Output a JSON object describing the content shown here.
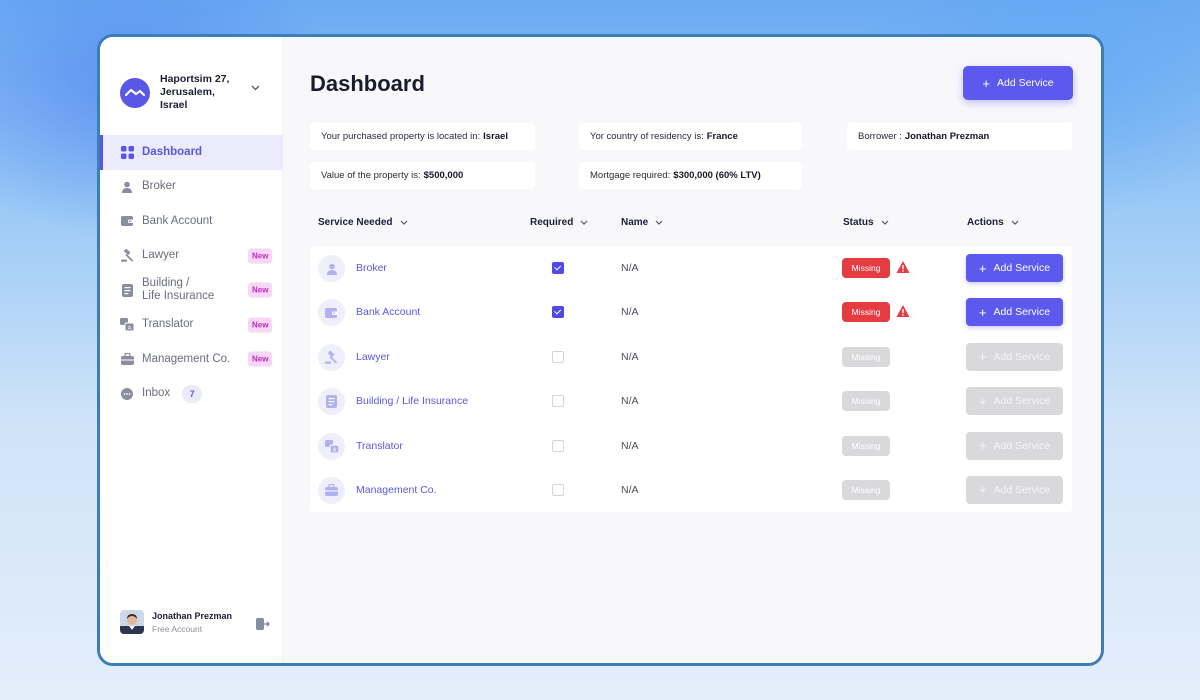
{
  "brand": {
    "address_line1": "Haportsim 27,",
    "address_line2": "Jerusalem, Israel"
  },
  "sidebar": {
    "items": [
      {
        "label": "Dashboard",
        "icon": "dashboard-icon",
        "active": true
      },
      {
        "label": "Broker",
        "icon": "user-icon"
      },
      {
        "label": "Bank Account",
        "icon": "wallet-icon"
      },
      {
        "label": "Lawyer",
        "icon": "gavel-icon",
        "badge": "New"
      },
      {
        "label": "Building /",
        "label2": "Life Insurance",
        "icon": "document-icon",
        "badge": "New"
      },
      {
        "label": "Translator",
        "icon": "translate-icon",
        "badge": "New"
      },
      {
        "label": "Management Co.",
        "icon": "briefcase-icon",
        "badge": "New"
      },
      {
        "label": "Inbox",
        "icon": "chat-icon",
        "count": "7"
      }
    ]
  },
  "user": {
    "name": "Jonathan Prezman",
    "plan": "Free Account"
  },
  "header": {
    "title": "Dashboard",
    "add_service_label": "Add Service"
  },
  "info": {
    "location_label": "Your purchased property is located in:",
    "location_value": "Israel",
    "residency_label": "Yor country of residency is:",
    "residency_value": "France",
    "borrower_label": "Borrower :",
    "borrower_value": "Jonathan Prezman",
    "value_label": "Value of the property is:",
    "value_value": "$500,000",
    "mortgage_label": "Mortgage required:",
    "mortgage_value": "$300,000 (60% LTV)"
  },
  "table": {
    "columns": [
      "Service Needed",
      "Required",
      "Name",
      "Status",
      "Actions"
    ],
    "rows": [
      {
        "service": "Broker",
        "icon": "user-icon",
        "required": true,
        "name": "N/A",
        "status": "Missing",
        "action": "Add Service"
      },
      {
        "service": "Bank Account",
        "icon": "wallet-icon",
        "required": true,
        "name": "N/A",
        "status": "Missing",
        "action": "Add Service"
      },
      {
        "service": "Lawyer",
        "icon": "gavel-icon",
        "required": false,
        "name": "N/A",
        "status": "Missing",
        "action": "Add Service"
      },
      {
        "service": "Building / Life Insurance",
        "icon": "document-icon",
        "required": false,
        "name": "N/A",
        "status": "Missing",
        "action": "Add Service"
      },
      {
        "service": "Translator",
        "icon": "translate-icon",
        "required": false,
        "name": "N/A",
        "status": "Missing",
        "action": "Add Service"
      },
      {
        "service": "Management Co.",
        "icon": "briefcase-icon",
        "required": false,
        "name": "N/A",
        "status": "Missing",
        "action": "Add Service"
      }
    ]
  },
  "colors": {
    "accent": "#5c59ee",
    "danger": "#e53b42",
    "disabled": "#d9d9dc",
    "badge_bg": "#f8d6f5",
    "badge_text": "#c02cc0"
  }
}
